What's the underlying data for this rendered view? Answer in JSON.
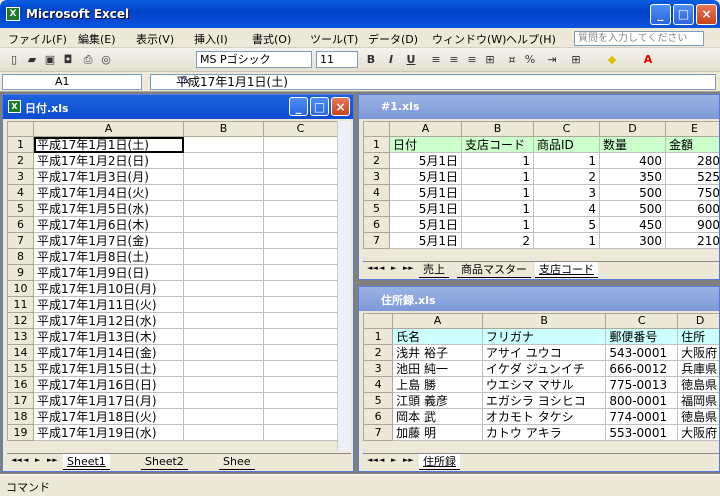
{
  "app": {
    "title": "Microsoft Excel",
    "ask_placeholder": "質問を入力してください"
  },
  "menu": [
    "ファイル(F)",
    "編集(E)",
    "表示(V)",
    "挿入(I)",
    "書式(O)",
    "ツール(T)",
    "データ(D)",
    "ウィンドウ(W)",
    "ヘルプ(H)"
  ],
  "toolbar": {
    "font": "MS Pゴシック",
    "size": "11",
    "bold": "B",
    "italic": "I",
    "underline": "U",
    "percent": "%"
  },
  "formula": {
    "cell": "A1",
    "fx": "fx",
    "value": "平成17年1月1日(土)"
  },
  "win1": {
    "title": "日付.xls",
    "cols": [
      "A",
      "B",
      "C"
    ],
    "rows": [
      "平成17年1月1日(土)",
      "平成17年1月2日(日)",
      "平成17年1月3日(月)",
      "平成17年1月4日(火)",
      "平成17年1月5日(水)",
      "平成17年1月6日(木)",
      "平成17年1月7日(金)",
      "平成17年1月8日(土)",
      "平成17年1月9日(日)",
      "平成17年1月10日(月)",
      "平成17年1月11日(火)",
      "平成17年1月12日(水)",
      "平成17年1月13日(木)",
      "平成17年1月14日(金)",
      "平成17年1月15日(土)",
      "平成17年1月16日(日)",
      "平成17年1月17日(月)",
      "平成17年1月18日(火)",
      "平成17年1月19日(水)"
    ],
    "tabs": [
      "Sheet1",
      "Sheet2",
      "Shee"
    ]
  },
  "win2": {
    "title": "#1.xls",
    "cols": [
      "A",
      "B",
      "C",
      "D",
      "E"
    ],
    "header": [
      "日付",
      "支店コード",
      "商品ID",
      "数量",
      "金額"
    ],
    "rows": [
      [
        "5月1日",
        "1",
        "1",
        "400",
        "280"
      ],
      [
        "5月1日",
        "1",
        "2",
        "350",
        "525"
      ],
      [
        "5月1日",
        "1",
        "3",
        "500",
        "750"
      ],
      [
        "5月1日",
        "1",
        "4",
        "500",
        "600"
      ],
      [
        "5月1日",
        "1",
        "5",
        "450",
        "900"
      ],
      [
        "5月1日",
        "2",
        "1",
        "300",
        "210"
      ]
    ],
    "tabs": [
      "売上",
      "商品マスター",
      "支店コード"
    ]
  },
  "win3": {
    "title": "住所録.xls",
    "cols": [
      "A",
      "B",
      "C",
      "D"
    ],
    "header": [
      "氏名",
      "フリガナ",
      "郵便番号",
      "住所"
    ],
    "rows": [
      [
        "浅井 裕子",
        "アサイ ユウコ",
        "543-0001",
        "大阪府"
      ],
      [
        "池田 純一",
        "イケダ ジュンイチ",
        "666-0012",
        "兵庫県"
      ],
      [
        "上島 勝",
        "ウエシマ マサル",
        "775-0013",
        "徳島県"
      ],
      [
        "江頭 義彦",
        "エガシラ ヨシヒコ",
        "800-0001",
        "福岡県"
      ],
      [
        "岡本 武",
        "オカモト タケシ",
        "774-0001",
        "徳島県"
      ],
      [
        "加藤 明",
        "カトウ アキラ",
        "553-0001",
        "大阪府"
      ]
    ],
    "tabs": [
      "住所録"
    ]
  },
  "status": "コマンド"
}
